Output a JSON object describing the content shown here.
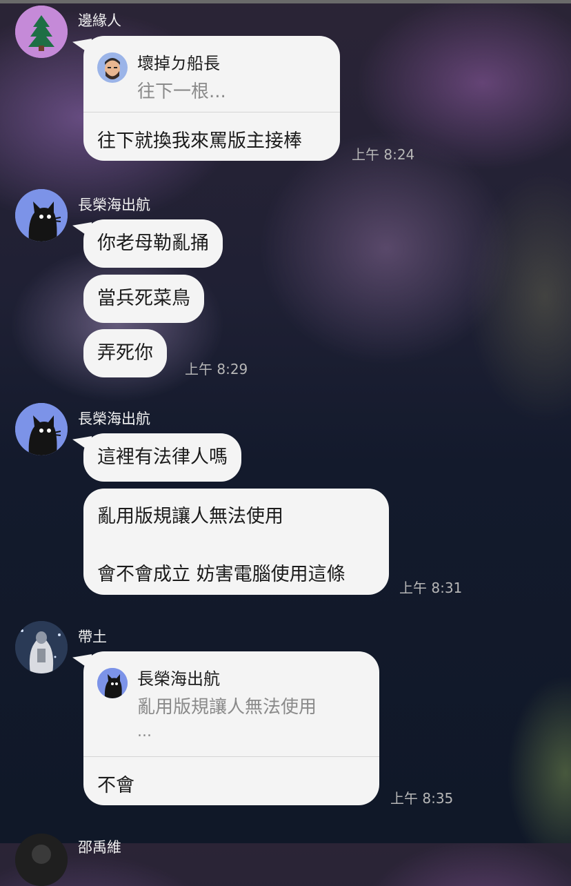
{
  "messages": [
    {
      "sender": "邊緣人",
      "avatar_icon": "tree-icon",
      "reply": {
        "name": "壞掉ㄉ船長",
        "avatar_icon": "bearded-man-icon",
        "text": "往下一根..."
      },
      "body": "往下就換我來罵版主接棒",
      "time": "上午 8:24"
    },
    {
      "sender": "長榮海出航",
      "avatar_icon": "black-cat-icon",
      "bubbles": [
        "你老母勒亂捅",
        "當兵死菜鳥",
        "弄死你"
      ],
      "time": "上午 8:29"
    },
    {
      "sender": "長榮海出航",
      "avatar_icon": "black-cat-icon",
      "bubbles": [
        "這裡有法律人嗎"
      ],
      "multi_line": [
        "亂用版規讓人無法使用",
        "會不會成立 妨害電腦使用這條"
      ],
      "time": "上午 8:31"
    },
    {
      "sender": "帶土",
      "avatar_icon": "hooded-figure-icon",
      "reply": {
        "name": "長榮海出航",
        "avatar_icon": "black-cat-icon",
        "text": "亂用版規讓人無法使用",
        "ellipsis": "..."
      },
      "body": "不會",
      "time": "上午 8:35"
    },
    {
      "sender": "邵禹維",
      "avatar_icon": "profile-icon"
    }
  ],
  "colors": {
    "bubble": "#f4f4f4",
    "text": "#1b1b1b",
    "muted": "#8a8a8a",
    "time": "#b7b7b7",
    "tree_avatar_bg": "#c58ad8",
    "cat_avatar_bg": "#7c93e8"
  }
}
